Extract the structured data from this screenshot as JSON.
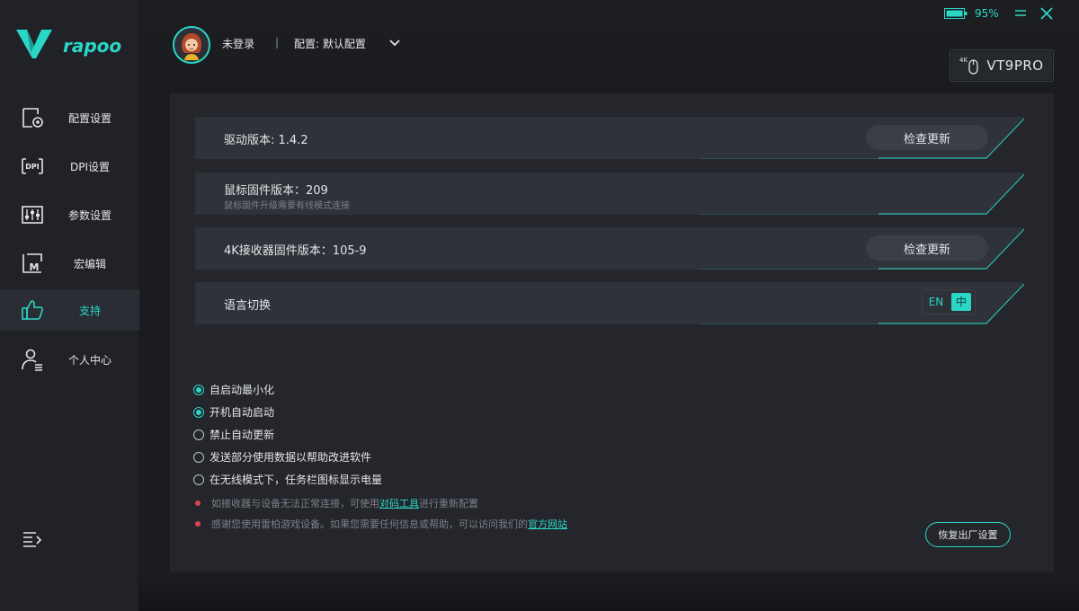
{
  "brand": {
    "name": "rapoo",
    "accent": "#2ad7c6"
  },
  "sidebar": {
    "items": [
      {
        "label": "配置设置",
        "icon": "config-icon"
      },
      {
        "label": "DPI设置",
        "icon": "dpi-icon"
      },
      {
        "label": "参数设置",
        "icon": "sliders-icon"
      },
      {
        "label": "宏编辑",
        "icon": "macro-icon"
      },
      {
        "label": "支持",
        "icon": "thumbs-up-icon",
        "active": true
      },
      {
        "label": "个人中心",
        "icon": "user-icon"
      }
    ]
  },
  "header": {
    "user": "未登录",
    "separator": "|",
    "config": "配置: 默认配置",
    "battery": "95%",
    "device": "VT9PRO",
    "device_tag": "4K"
  },
  "support": {
    "rows": [
      {
        "title": "驱动版本: 1.4.2",
        "button": "检查更新"
      },
      {
        "title": "鼠标固件版本：209",
        "subtitle": "鼠标固件升级需要有线模式连接"
      },
      {
        "title": "4K接收器固件版本：105-9",
        "button": "检查更新"
      },
      {
        "title": "语言切换",
        "lang_en": "EN",
        "lang_zh": "中"
      }
    ],
    "options": [
      {
        "label": "自启动最小化",
        "checked": true
      },
      {
        "label": "开机自动启动",
        "checked": true
      },
      {
        "label": "禁止自动更新",
        "checked": false
      },
      {
        "label": "发送部分使用数据以帮助改进软件",
        "checked": false
      },
      {
        "label": "在无线模式下，任务栏图标显示电量",
        "checked": false
      }
    ],
    "notes": [
      {
        "prefix": "如接收器与设备无法正常连接，可使用",
        "link": "对码工具",
        "suffix": "进行重新配置"
      },
      {
        "prefix": "感谢您使用雷柏游戏设备。如果您需要任何信息或帮助，可以访问我们的",
        "link": "官方网站",
        "suffix": ""
      }
    ],
    "reset_button": "恢复出厂设置"
  }
}
